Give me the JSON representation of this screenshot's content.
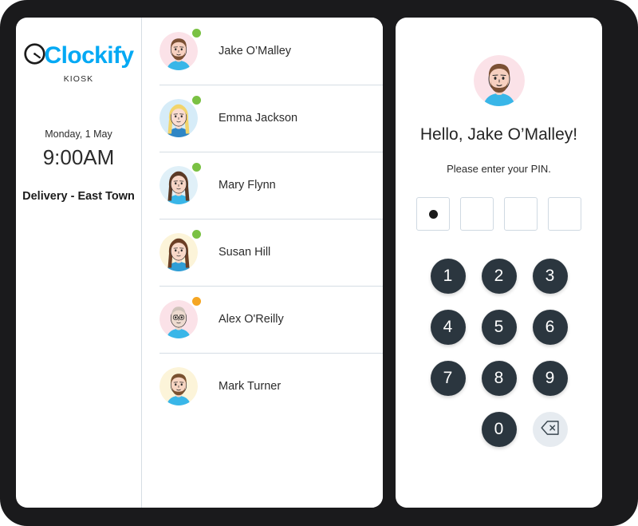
{
  "app": {
    "brand_name": "Clockify",
    "brand_subtitle": "KIOSK",
    "brand_color": "#03a9f4",
    "key_color": "#2b363f",
    "status_active_color": "#7ac143",
    "status_break_color": "#f5a623"
  },
  "sidebar": {
    "date": "Monday, 1 May",
    "time": "9:00AM",
    "location": "Delivery - East Town"
  },
  "user_list": {
    "users": [
      {
        "name": "Jake O’Malley",
        "status": "active",
        "avatar": "avatar-jake"
      },
      {
        "name": "Emma Jackson",
        "status": "active",
        "avatar": "avatar-emma"
      },
      {
        "name": "Mary Flynn",
        "status": "active",
        "avatar": "avatar-mary"
      },
      {
        "name": "Susan Hill",
        "status": "active",
        "avatar": "avatar-susan"
      },
      {
        "name": "Alex O'Reilly",
        "status": "break",
        "avatar": "avatar-alex"
      },
      {
        "name": "Mark Turner",
        "status": "offline",
        "avatar": "avatar-mark"
      }
    ]
  },
  "pin_screen": {
    "avatar": "avatar-jake",
    "greeting": "Hello, Jake O’Malley!",
    "prompt": "Please enter your PIN.",
    "pin_length": 4,
    "pin_filled": 1,
    "keys": [
      "1",
      "2",
      "3",
      "4",
      "5",
      "6",
      "7",
      "8",
      "9",
      "",
      "0",
      "backspace"
    ],
    "backspace_label": "backspace-icon"
  }
}
